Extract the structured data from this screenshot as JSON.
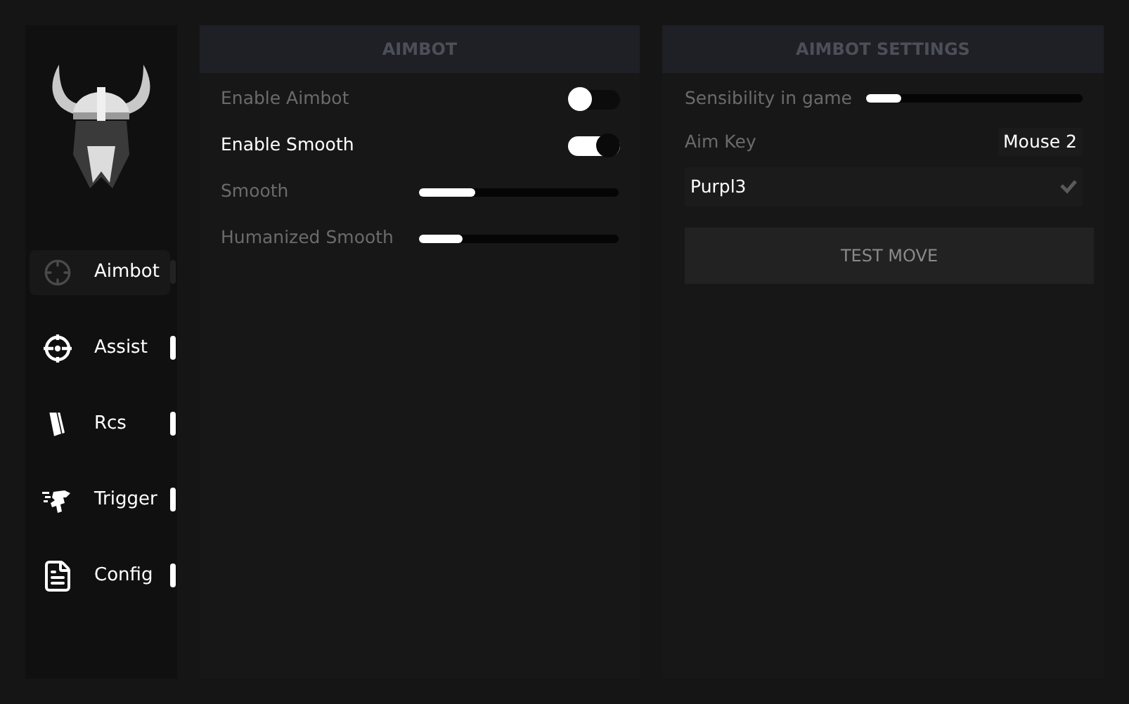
{
  "sidebar": {
    "items": [
      {
        "label": "Aimbot",
        "kind": "crosshair",
        "selected": true
      },
      {
        "label": "Assist",
        "kind": "scope",
        "selected": false
      },
      {
        "label": "Rcs",
        "kind": "magazine",
        "selected": false
      },
      {
        "label": "Trigger",
        "kind": "runner",
        "selected": false
      },
      {
        "label": "Config",
        "kind": "file",
        "selected": false
      }
    ]
  },
  "aimbot_panel": {
    "title": "AIMBOT",
    "rows": [
      {
        "kind": "toggle",
        "label": "Enable Aimbot",
        "on": false
      },
      {
        "kind": "toggle",
        "label": "Enable Smooth",
        "on": true
      },
      {
        "kind": "slider",
        "label": "Smooth",
        "level": 0.28
      },
      {
        "kind": "slider",
        "label": "Humanized Smooth",
        "level": 0.22
      }
    ]
  },
  "settings_panel": {
    "title": "AIMBOT SETTINGS",
    "sensibility": {
      "label": "Sensibility in game",
      "level": 0.16
    },
    "aim_key": {
      "label": "Aim Key",
      "value": "Mouse 2"
    },
    "profile": {
      "value": "Purpl3"
    },
    "button": "TEST MOVE"
  }
}
